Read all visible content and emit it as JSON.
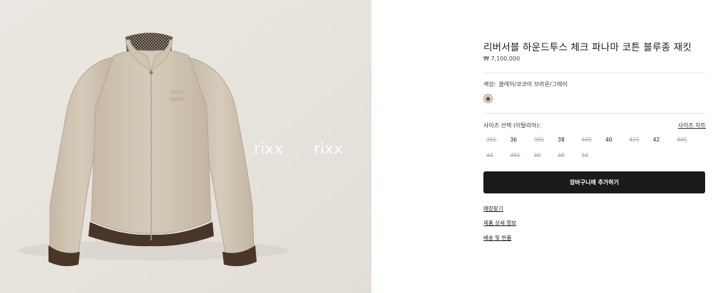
{
  "gallery": {
    "watermarks": [
      "rixx",
      "rixx"
    ]
  },
  "product": {
    "title": "리버서블 하운드투스 체크 파나마 코튼 블루종 재킷",
    "price": "₩ 7,100,000",
    "color_label": "색상:",
    "color_name": "클레이/코코아 브라운/그레이",
    "size_label": "사이즈 선택 (이탈리아):",
    "size_chart": "사이즈 차트",
    "sizes": [
      {
        "label": "36S",
        "available": false
      },
      {
        "label": "36",
        "available": true
      },
      {
        "label": "38S",
        "available": false
      },
      {
        "label": "38",
        "available": true
      },
      {
        "label": "40S",
        "available": false
      },
      {
        "label": "40",
        "available": true
      },
      {
        "label": "42S",
        "available": false
      },
      {
        "label": "42",
        "available": true
      },
      {
        "label": "44S",
        "available": false
      },
      {
        "label": "44",
        "available": false
      },
      {
        "label": "46S",
        "available": false
      },
      {
        "label": "46",
        "available": false
      },
      {
        "label": "48",
        "available": false
      },
      {
        "label": "50",
        "available": false
      }
    ],
    "add_to_cart": "장바구니에 추가하기",
    "links": [
      "매장찾기",
      "제품 상세 정보",
      "배송 및 반품"
    ]
  }
}
